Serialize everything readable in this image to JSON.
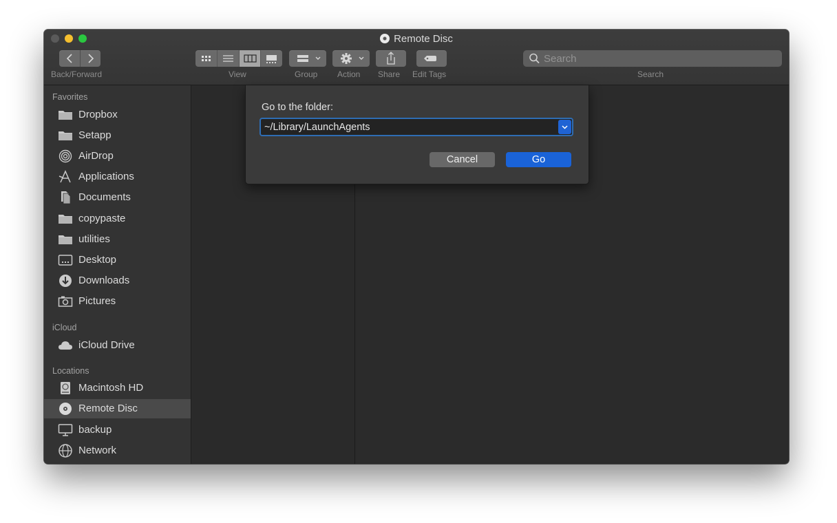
{
  "window": {
    "title": "Remote Disc"
  },
  "toolbar": {
    "back_forward_label": "Back/Forward",
    "view_label": "View",
    "group_label": "Group",
    "action_label": "Action",
    "share_label": "Share",
    "edit_tags_label": "Edit Tags",
    "search_label": "Search",
    "search_placeholder": "Search",
    "active_view": "columns"
  },
  "sidebar": {
    "sections": [
      {
        "title": "Favorites"
      },
      {
        "title": "iCloud"
      },
      {
        "title": "Locations"
      }
    ],
    "favorites": [
      {
        "label": "Dropbox",
        "icon": "folder-icon"
      },
      {
        "label": "Setapp",
        "icon": "folder-icon"
      },
      {
        "label": "AirDrop",
        "icon": "airdrop-icon"
      },
      {
        "label": "Applications",
        "icon": "applications-icon"
      },
      {
        "label": "Documents",
        "icon": "documents-icon"
      },
      {
        "label": "copypaste",
        "icon": "folder-icon"
      },
      {
        "label": "utilities",
        "icon": "folder-icon"
      },
      {
        "label": "Desktop",
        "icon": "desktop-icon"
      },
      {
        "label": "Downloads",
        "icon": "downloads-icon"
      },
      {
        "label": "Pictures",
        "icon": "pictures-icon"
      }
    ],
    "icloud": [
      {
        "label": "iCloud Drive",
        "icon": "cloud-icon"
      }
    ],
    "locations": [
      {
        "label": "Macintosh HD",
        "icon": "hard-drive-icon"
      },
      {
        "label": "Remote Disc",
        "icon": "disc-icon",
        "selected": true
      },
      {
        "label": "backup",
        "icon": "display-icon"
      },
      {
        "label": "Network",
        "icon": "network-icon"
      }
    ]
  },
  "dialog": {
    "label": "Go to the folder:",
    "path_value": "~/Library/LaunchAgents",
    "cancel_label": "Cancel",
    "go_label": "Go"
  },
  "colors": {
    "accent": "#1a63d8",
    "focus_ring": "#2e6db4",
    "close": "#5a5a5a",
    "minimize": "#f5bf2f",
    "maximize": "#2ac840"
  }
}
